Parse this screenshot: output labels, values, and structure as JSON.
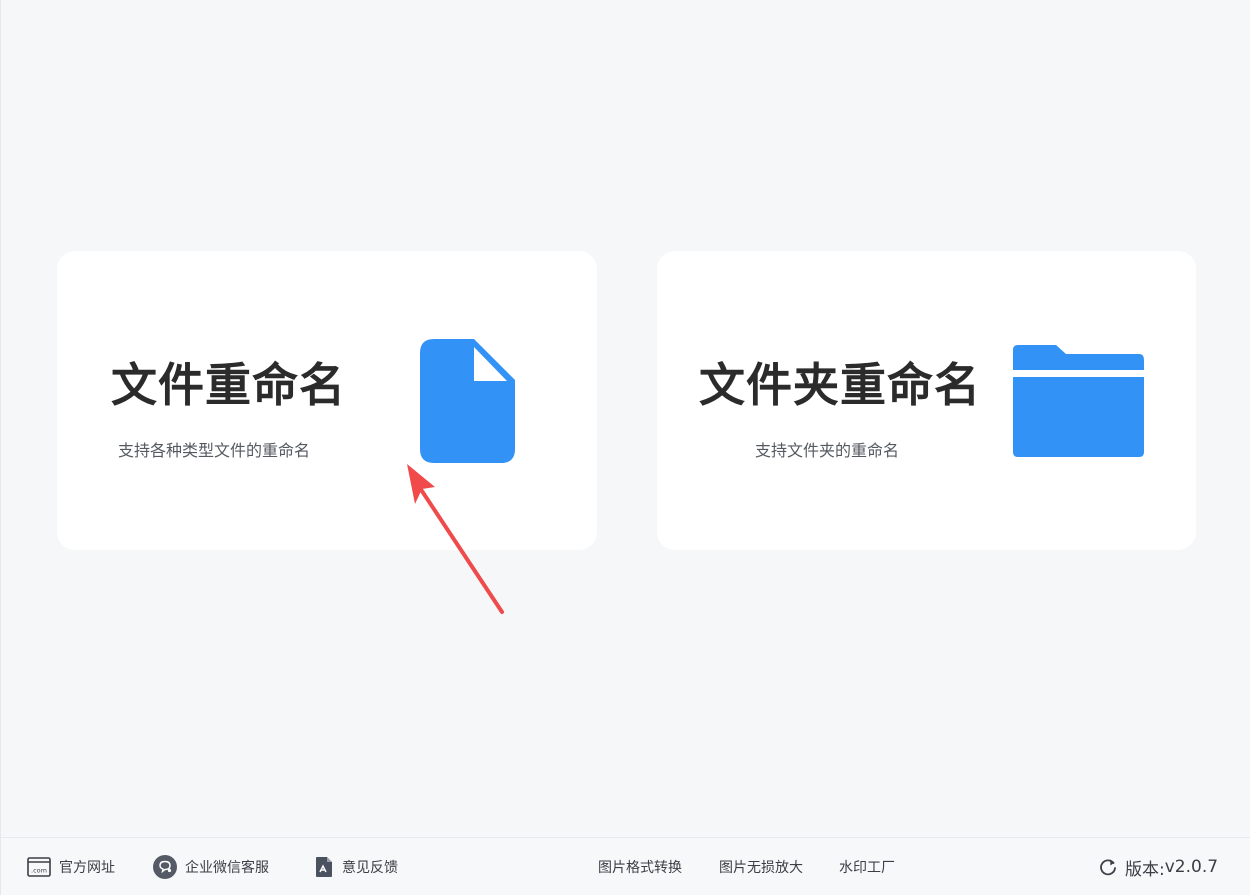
{
  "cards": [
    {
      "title": "文件重命名",
      "desc": "支持各种类型文件的重命名",
      "icon": "file-icon"
    },
    {
      "title": "文件夹重命名",
      "desc": "支持文件夹的重命名",
      "icon": "folder-icon"
    }
  ],
  "footer": {
    "official_site": "官方网址",
    "wechat_service": "企业微信客服",
    "feedback": "意见反馈",
    "image_convert": "图片格式转换",
    "image_enlarge": "图片无损放大",
    "watermark_factory": "水印工厂",
    "version_label": "版本:",
    "version_value": "v2.0.7"
  },
  "colors": {
    "accent": "#3292f5",
    "arrow": "#f04a4a",
    "card_bg": "#ffffff",
    "page_bg": "#f6f7f9"
  }
}
